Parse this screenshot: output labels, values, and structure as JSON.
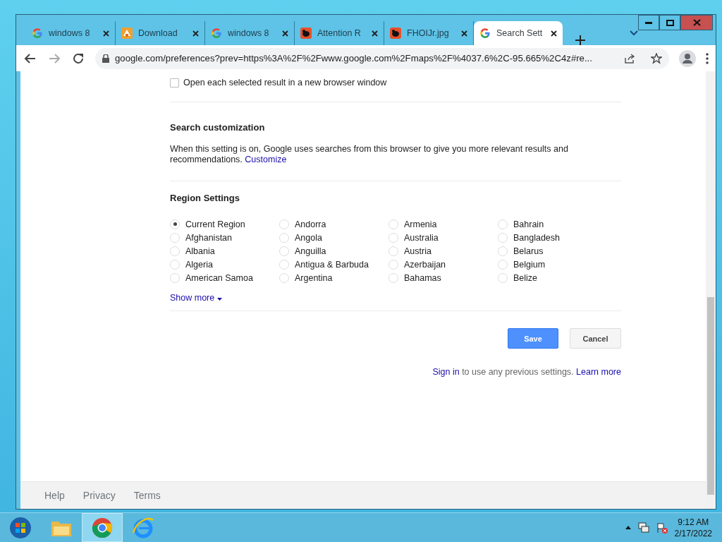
{
  "tabs": [
    {
      "title": "windows 8",
      "kind": "google",
      "selected": false
    },
    {
      "title": "Download",
      "kind": "download",
      "selected": false
    },
    {
      "title": "windows 8",
      "kind": "google",
      "selected": false
    },
    {
      "title": "Attention R",
      "kind": "monkey",
      "selected": false
    },
    {
      "title": "FHOIJr.jpg",
      "kind": "monkey",
      "selected": false
    },
    {
      "title": "Search Sett",
      "kind": "google",
      "selected": true
    }
  ],
  "address_bar": {
    "url": "google.com/preferences?prev=https%3A%2F%2Fwww.google.com%2Fmaps%2F%4037.6%2C-95.665%2C4z#re..."
  },
  "results_window": {
    "checkbox_label": "Open each selected result in a new browser window",
    "checked": false
  },
  "search_customization": {
    "heading": "Search customization",
    "text": "When this setting is on, Google uses searches from this browser to give you more relevant results and recommendations.",
    "link": "Customize"
  },
  "region_settings": {
    "heading": "Region Settings",
    "regions": [
      {
        "label": "Current Region",
        "selected": true
      },
      {
        "label": "Afghanistan",
        "selected": false
      },
      {
        "label": "Albania",
        "selected": false
      },
      {
        "label": "Algeria",
        "selected": false
      },
      {
        "label": "American Samoa",
        "selected": false
      },
      {
        "label": "Andorra",
        "selected": false
      },
      {
        "label": "Angola",
        "selected": false
      },
      {
        "label": "Anguilla",
        "selected": false
      },
      {
        "label": "Antigua & Barbuda",
        "selected": false
      },
      {
        "label": "Argentina",
        "selected": false
      },
      {
        "label": "Armenia",
        "selected": false
      },
      {
        "label": "Australia",
        "selected": false
      },
      {
        "label": "Austria",
        "selected": false
      },
      {
        "label": "Azerbaijan",
        "selected": false
      },
      {
        "label": "Bahamas",
        "selected": false
      },
      {
        "label": "Bahrain",
        "selected": false
      },
      {
        "label": "Bangladesh",
        "selected": false
      },
      {
        "label": "Belarus",
        "selected": false
      },
      {
        "label": "Belgium",
        "selected": false
      },
      {
        "label": "Belize",
        "selected": false
      }
    ],
    "show_more": "Show more"
  },
  "buttons": {
    "save": "Save",
    "cancel": "Cancel"
  },
  "sign_in_note": {
    "link": "Sign in",
    "text": "to use any previous settings.",
    "learn_more": "Learn more"
  },
  "footer": [
    "Help",
    "Privacy",
    "Terms"
  ],
  "taskbar": {
    "apps": [
      {
        "kind": "start",
        "selected": false
      },
      {
        "kind": "folder",
        "selected": false
      },
      {
        "kind": "chrome",
        "selected": true
      },
      {
        "kind": "ie",
        "selected": false
      }
    ],
    "time": "9:12 AM",
    "date": "2/17/2022"
  }
}
